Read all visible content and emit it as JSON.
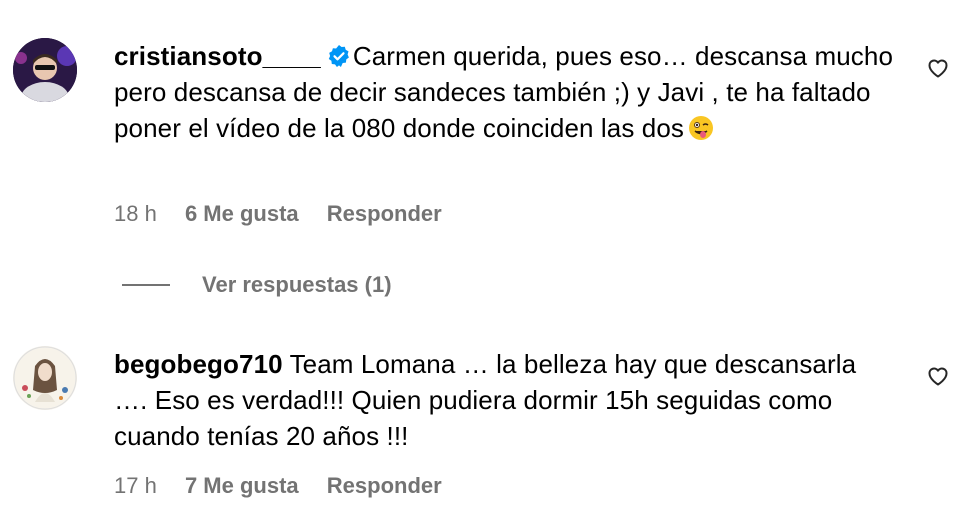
{
  "comments": [
    {
      "username": "cristiansoto____",
      "verified": true,
      "text": "Carmen querida, pues eso… descansa mucho pero descansa de decir sandeces también ;) y Javi , te ha faltado poner el vídeo de la 080 donde coinciden las dos",
      "emoji": "winking-face-with-tongue",
      "time": "18 h",
      "likes": "6 Me gusta",
      "reply_label": "Responder",
      "view_replies": "Ver respuestas (1)"
    },
    {
      "username": "begobego710",
      "verified": false,
      "text": "Team Lomana … la belleza hay que descansarla …. Eso es verdad!!! Quien pudiera dormir 15h seguidas como cuando tenías 20 años !!!",
      "time": "17 h",
      "likes": "7 Me gusta",
      "reply_label": "Responder"
    }
  ],
  "colors": {
    "text": "#000000",
    "secondary": "#737373",
    "verified": "#0095f6"
  },
  "icons": [
    "verified-badge-icon",
    "heart-outline-icon",
    "winking-face-with-tongue-emoji"
  ]
}
